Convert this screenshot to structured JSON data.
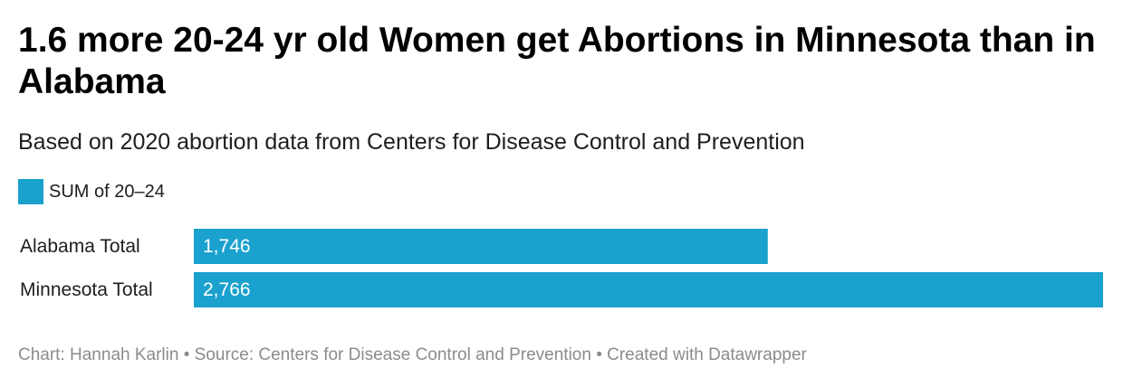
{
  "title": "1.6 more 20-24 yr old Women get Abortions in Minnesota than in Alabama",
  "subtitle": "Based on 2020 abortion data from Centers for Disease Control and Prevention",
  "legend": {
    "label": "SUM of 20–24",
    "color": "#1aa1cd"
  },
  "footer": "Chart: Hannah Karlin • Source: Centers for Disease Control and Prevention • Created with Datawrapper",
  "chart_data": {
    "type": "bar",
    "orientation": "horizontal",
    "title": "1.6 more 20-24 yr old Women get Abortions in Minnesota than in Alabama",
    "subtitle": "Based on 2020 abortion data from Centers for Disease Control and Prevention",
    "categories": [
      "Alabama Total",
      "Minnesota Total"
    ],
    "series": [
      {
        "name": "SUM of 20–24",
        "values": [
          1746,
          2766
        ],
        "labels": [
          "1,746",
          "2,766"
        ],
        "color": "#1aa1cd"
      }
    ],
    "xlim": [
      0,
      2766
    ],
    "grid": false,
    "legend_position": "top-left",
    "bar_label_color": "#ffffff"
  }
}
